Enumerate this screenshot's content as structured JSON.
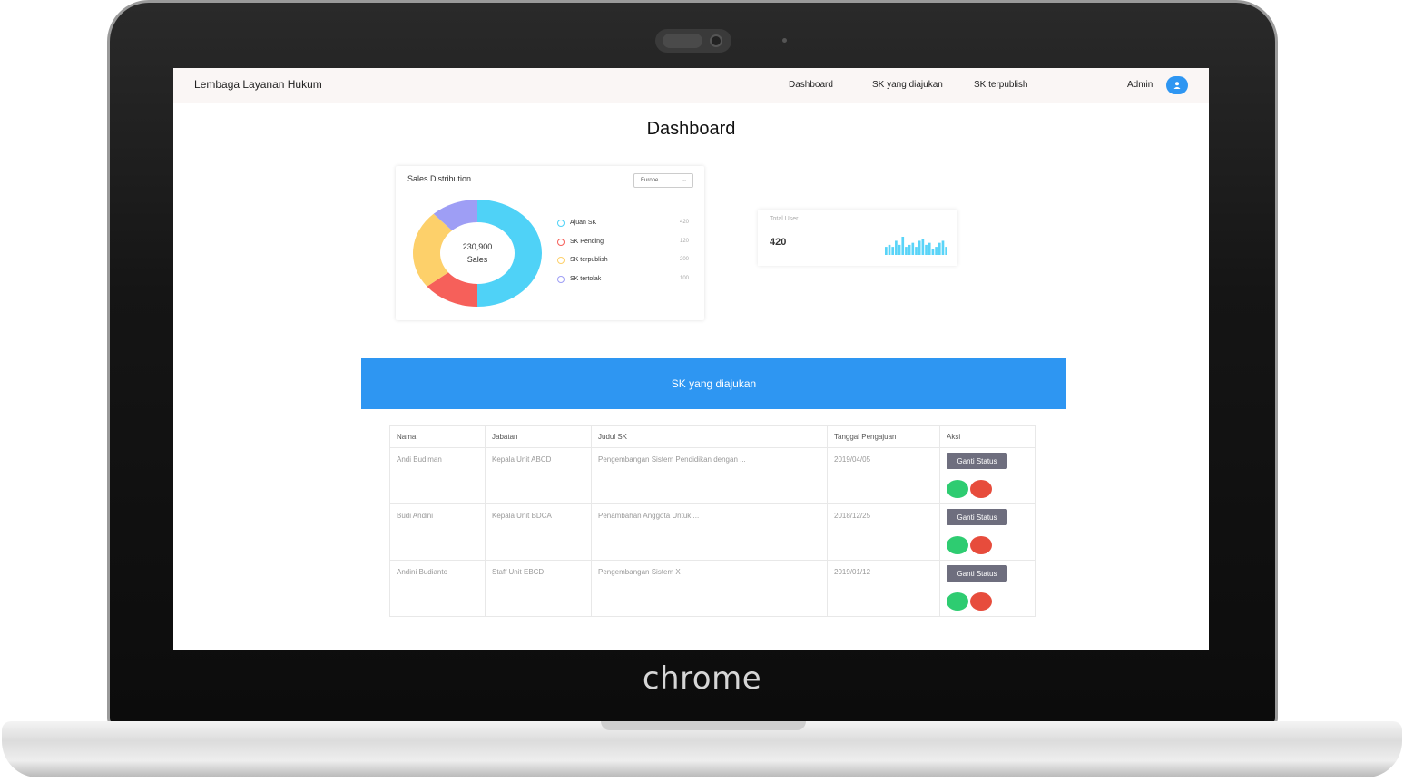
{
  "device": {
    "logo_text": "chrome"
  },
  "navbar": {
    "brand": "Lembaga Layanan Hukum",
    "links": [
      "Dashboard",
      "SK yang diajukan",
      "SK terpublish"
    ],
    "user": "Admin",
    "avatar_icon": "user-icon",
    "accent_color": "#2e96f2"
  },
  "page": {
    "title": "Dashboard"
  },
  "sales_card": {
    "title": "Sales Distribution",
    "region": "Europe",
    "center_value": "230,900",
    "center_label": "Sales",
    "legend": [
      {
        "label": "Ajuan SK",
        "value": "420",
        "color": "#4fd2f7"
      },
      {
        "label": "SK Pending",
        "value": "120",
        "color": "#f6605a"
      },
      {
        "label": "SK terpublish",
        "value": "200",
        "color": "#fdd06a"
      },
      {
        "label": "SK tertolak",
        "value": "100",
        "color": "#9e9ef5"
      }
    ]
  },
  "chart_data": {
    "type": "pie",
    "title": "Sales Distribution",
    "categories": [
      "Ajuan SK",
      "SK Pending",
      "SK terpublish",
      "SK tertolak"
    ],
    "values": [
      420,
      120,
      200,
      100
    ],
    "center_text": "230,900 Sales",
    "colors": [
      "#4fd2f7",
      "#f6605a",
      "#fdd06a",
      "#9e9ef5"
    ],
    "legend_position": "right"
  },
  "user_card": {
    "title": "Total User",
    "value": "420",
    "spark_values": [
      4,
      5,
      4,
      7,
      5,
      9,
      4,
      5,
      6,
      4,
      7,
      8,
      5,
      6,
      3,
      4,
      6,
      7,
      4
    ]
  },
  "banner": {
    "label": "SK yang diajukan",
    "color": "#2e96f2"
  },
  "table": {
    "headers": [
      "Nama",
      "Jabatan",
      "Judul SK",
      "Tanggal Pengajuan",
      "Aksi"
    ],
    "rows": [
      {
        "nama": "Andi Budiman",
        "jabatan": "Kepala Unit ABCD",
        "judul": "Pengembangan Sistem Pendidikan dengan ...",
        "tanggal": "2019/04/05",
        "action": "Ganti Status"
      },
      {
        "nama": "Budi Andini",
        "jabatan": "Kepala Unit BDCA",
        "judul": "Penambahan Anggota Untuk ...",
        "tanggal": "2018/12/25",
        "action": "Ganti Status"
      },
      {
        "nama": "Andini Budianto",
        "jabatan": "Staff Unit EBCD",
        "judul": "Pengembangan Sistem X",
        "tanggal": "2019/01/12",
        "action": "Ganti Status"
      }
    ],
    "approve_color": "#2ecc71",
    "reject_color": "#e74c3c"
  }
}
